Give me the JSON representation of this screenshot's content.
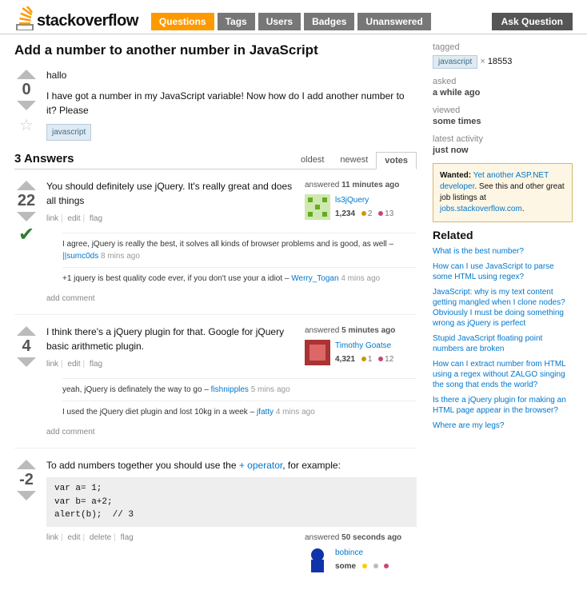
{
  "header": {
    "site": "stackoverflow",
    "tabs": [
      "Questions",
      "Tags",
      "Users",
      "Badges",
      "Unanswered"
    ],
    "ask": "Ask Question"
  },
  "question": {
    "title": "Add a number to another number in JavaScript",
    "score": "0",
    "body1": "hallo",
    "body2": "I have got a number in my JavaScript variable! Now how do I add another number to it? Please",
    "tags": [
      "javascript"
    ]
  },
  "answers_header": "3 Answers",
  "sort": {
    "oldest": "oldest",
    "newest": "newest",
    "votes": "votes"
  },
  "answers": [
    {
      "score": "22",
      "body": "You should definitely use jQuery. It's really great and does all things",
      "actions": [
        "link",
        "edit",
        "flag"
      ],
      "when_pre": "answered ",
      "when_bold": "11 minutes ago",
      "user": "ls3jQuery",
      "rep": "1,234",
      "badges": [
        {
          "c": "#c90",
          "n": "2"
        },
        {
          "c": "#c47",
          "n": "13"
        }
      ],
      "comments": [
        {
          "text": "I agree, jQuery is really the best, it solves all kinds of browser problems and is good, as well – ",
          "author": "||sumc0ds",
          "when": "8 mins ago"
        },
        {
          "text": "+1 jquery is best quality code ever, if you don't use your a idiot – ",
          "author": "Werry_Togan",
          "when": "4 mins ago"
        }
      ],
      "addc": "add comment"
    },
    {
      "score": "4",
      "body": "I think there's a jQuery plugin for that. Google for jQuery basic arithmetic plugin.",
      "actions": [
        "link",
        "edit",
        "flag"
      ],
      "when_pre": "answered ",
      "when_bold": "5 minutes ago",
      "user": "Timothy Goatse",
      "rep": "4,321",
      "badges": [
        {
          "c": "#c90",
          "n": "1"
        },
        {
          "c": "#c47",
          "n": "12"
        }
      ],
      "comments": [
        {
          "text": "yeah, jQuery is definately the way to go – ",
          "author": "fishnipples",
          "when": "5 mins ago"
        },
        {
          "text": "I used the jQuery diet plugin and lost 10kg in a week – ",
          "author": "jfatty",
          "when": "4 mins ago"
        }
      ],
      "addc": "add comment"
    },
    {
      "score": "-2",
      "body_pre": "To add numbers together you should use the ",
      "body_link": "+ operator",
      "body_post": ", for example:",
      "code": "var a= 1;\nvar b= a+2;\nalert(b);  // 3",
      "actions": [
        "link",
        "edit",
        "delete",
        "flag"
      ],
      "when_pre": "answered ",
      "when_bold": "50 seconds ago",
      "user": "bobince",
      "rep": "some",
      "badges": [
        {
          "c": "#fc0",
          "n": ""
        },
        {
          "c": "#bbb",
          "n": ""
        },
        {
          "c": "#c47",
          "n": ""
        }
      ]
    }
  ],
  "sidebar": {
    "tagged": {
      "label": "tagged",
      "tag": "javascript",
      "x": "×",
      "count": "18553"
    },
    "asked": {
      "label": "asked",
      "val": "a while ago"
    },
    "viewed": {
      "label": "viewed",
      "val": "some times"
    },
    "activity": {
      "label": "latest activity",
      "val": "just now"
    },
    "jobs": {
      "label": "Wanted:",
      "link1": "Yet another ASP.NET developer",
      "mid": ". See this and other great job listings at ",
      "link2": "jobs.stackoverflow.com"
    },
    "related_h": "Related",
    "related": [
      "What is the best number?",
      "How can I use JavaScript to parse some HTML using regex?",
      "JavaScript: why is my text content getting mangled when I clone nodes? Obviously I must be doing something wrong as jQuery is perfect",
      "Stupid JavaScript floating point numbers are broken",
      "How can I extract number from HTML using a regex without ZALGO singing the song that ends the world?",
      "Is there a jQuery plugin for making an HTML page appear in the browser?",
      "Where are my legs?"
    ]
  }
}
